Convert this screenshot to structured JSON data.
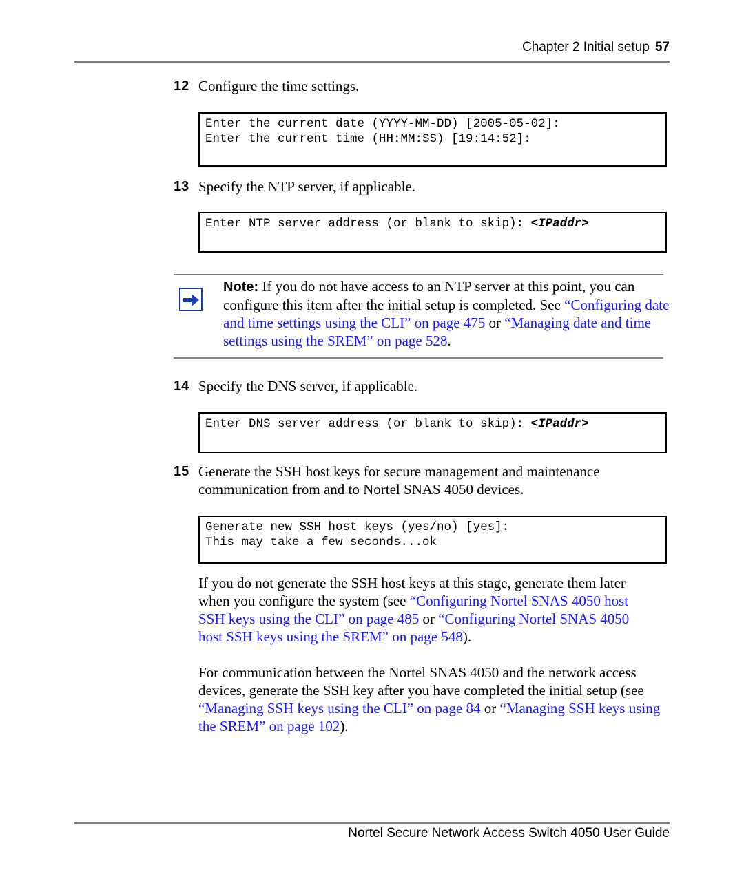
{
  "header": {
    "chapter": "Chapter 2  Initial setup",
    "page_number": "57"
  },
  "steps": [
    {
      "number": "12",
      "text": "Configure the time settings.",
      "code_lines": [
        "Enter the current date (YYYY-MM-DD) [2005-05-02]:",
        "Enter the current time (HH:MM:SS) [19:14:52]:"
      ]
    },
    {
      "number": "13",
      "text": "Specify the NTP server, if applicable.",
      "code_prefix": "Enter NTP server address (or blank to skip): ",
      "code_param": "<IPaddr>"
    },
    {
      "number": "14",
      "text": "Specify the DNS server, if applicable.",
      "code_prefix": "Enter DNS server address (or blank to skip): ",
      "code_param": "<IPaddr>"
    },
    {
      "number": "15",
      "text_line1": "Generate the SSH host keys for secure management and maintenance",
      "text_line2": "communication from and to Nortel SNAS 4050 devices.",
      "code_lines": [
        "Generate new SSH host keys (yes/no) [yes]:",
        "This may take a few seconds...ok"
      ]
    }
  ],
  "note": {
    "icon": "arrow-right-icon",
    "label": "Note:",
    "text1": " If you do not have access to an NTP server at this point, you can configure this item after the initial setup is completed. See ",
    "link1": "“Configuring date and time settings using the CLI” on page 475",
    "text2": " or ",
    "link2": "“Managing date and time settings using the SREM” on page 528",
    "text3": "."
  },
  "para1": {
    "text1": "If you do not generate the SSH host keys at this stage, generate them later when you configure the system (see ",
    "link1": "“Configuring Nortel SNAS 4050 host SSH keys using the CLI” on page 485",
    "text2": " or ",
    "link2": "“Configuring Nortel SNAS 4050 host SSH keys using the SREM” on page 548",
    "text3": ")."
  },
  "para2": {
    "text1": "For communication between the Nortel SNAS 4050 and the network access devices, generate the SSH key after you have completed the initial setup (see ",
    "link1": "“Managing SSH keys using the CLI” on page 84",
    "text2": " or ",
    "link2": "“Managing SSH keys using the SREM” on page 102",
    "text3": ")."
  },
  "footer": {
    "title": "Nortel Secure Network Access Switch 4050 User Guide"
  },
  "colors": {
    "link": "#1a1aff",
    "note_icon": "#1a3fb0",
    "rule": "#808080"
  }
}
